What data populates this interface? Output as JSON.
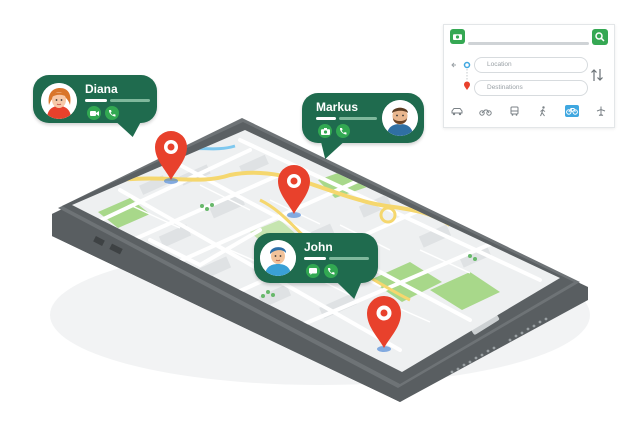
{
  "contacts": [
    {
      "name": "Diana",
      "actions": [
        "video-call",
        "phone-call"
      ]
    },
    {
      "name": "Markus",
      "actions": [
        "camera",
        "phone-call"
      ]
    },
    {
      "name": "John",
      "actions": [
        "message",
        "phone-call"
      ]
    }
  ],
  "route_panel": {
    "location_placeholder": "Location",
    "destinations_placeholder": "Destinations",
    "transport_modes": [
      "car",
      "motorbike",
      "bus",
      "walk",
      "bicycle",
      "flight"
    ],
    "active_mode": "bicycle"
  },
  "colors": {
    "bubble": "#1f6b4e",
    "action_green": "#32a852",
    "pin_red": "#e8412c",
    "phone_body": "#6b6f72",
    "map_land": "#eef0f1",
    "map_park": "#a8d88a",
    "map_road_yellow": "#f5d76e",
    "active_mode_blue": "#3fa7e0"
  }
}
